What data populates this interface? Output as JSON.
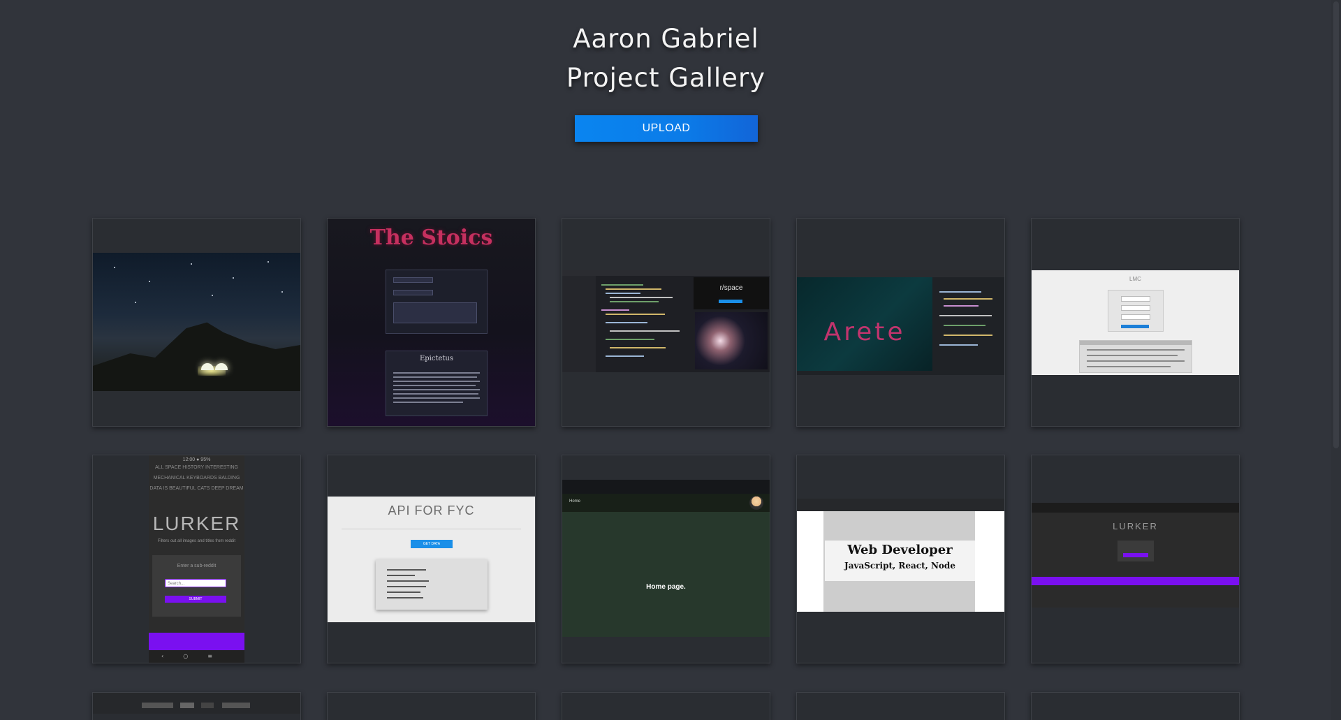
{
  "header": {
    "name": "Aaron Gabriel",
    "subtitle": "Project Gallery"
  },
  "upload_button": {
    "label": "UPLOAD",
    "color": "#0a85f0"
  },
  "gallery": {
    "cards": [
      {
        "kind": "night-sky-photo"
      },
      {
        "kind": "stoics-site",
        "title": "The Stoics",
        "quote_author": "Epictetus"
      },
      {
        "kind": "code-editor-space",
        "label": "r/space"
      },
      {
        "kind": "arete-site",
        "title": "Arete"
      },
      {
        "kind": "login-form",
        "label": "LMC"
      },
      {
        "kind": "lurker-mobile",
        "nav": [
          "ALL  SPACE  HISTORY  INTERESTING",
          "MECHANICAL KEYBOARDS  BALDING",
          "DATA IS BEAUTIFUL  CATS  DEEP DREAM"
        ],
        "title": "LURKER",
        "subtitle": "Filters out all images and titles from reddit",
        "prompt": "Enter a sub-reddit",
        "placeholder": "Search...",
        "submit": "SUBMIT"
      },
      {
        "kind": "api-site",
        "title": "API FOR FYC",
        "button": "GET DATA"
      },
      {
        "kind": "home-page",
        "nav_label": "Home",
        "body_text": "Home page."
      },
      {
        "kind": "web-dev-banner",
        "line1": "Web Developer",
        "line2": "JavaScript, React, Node"
      },
      {
        "kind": "lurker-desktop",
        "title": "LURKER"
      }
    ]
  },
  "colors": {
    "background": "#31343b",
    "card": "#2a2d32",
    "accent_purple": "#7a10f0",
    "accent_pink": "#c5305f"
  }
}
